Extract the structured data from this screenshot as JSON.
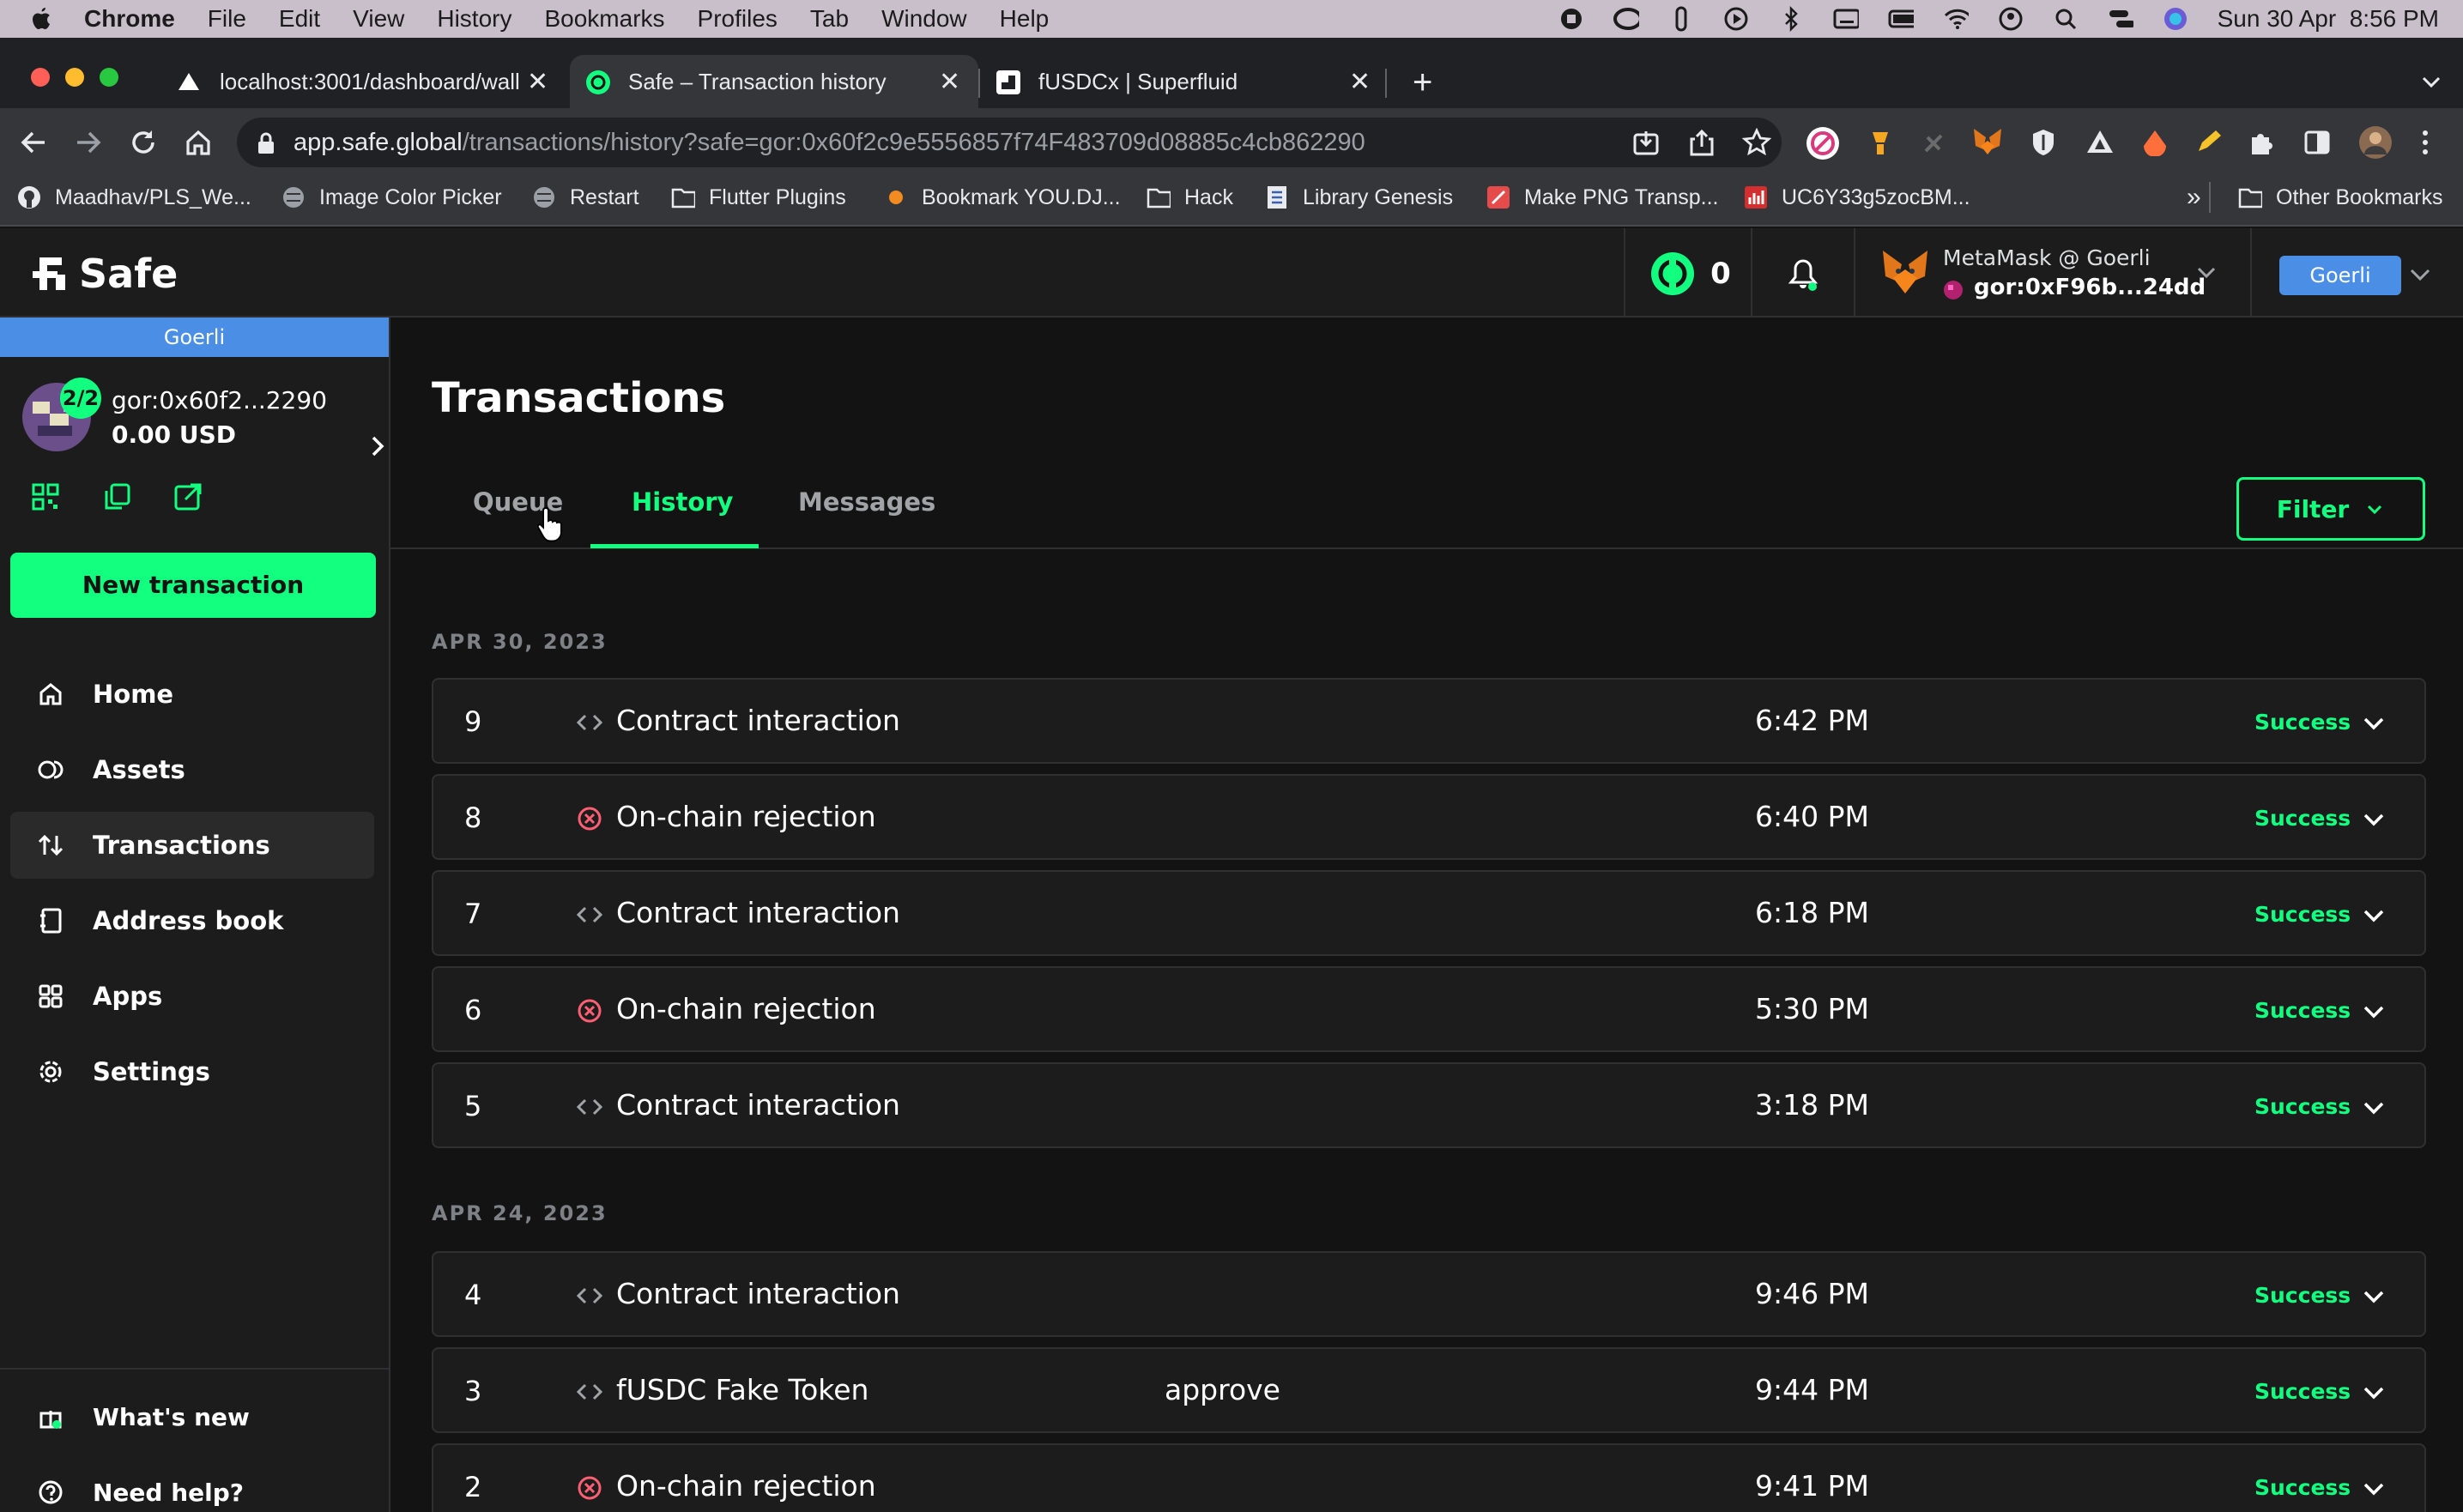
{
  "menubar": {
    "app": "Chrome",
    "items": [
      "File",
      "Edit",
      "View",
      "History",
      "Bookmarks",
      "Profiles",
      "Tab",
      "Window",
      "Help"
    ],
    "clock": "Sun 30 Apr  8:56 PM"
  },
  "browser": {
    "tabs": [
      {
        "title": "localhost:3001/dashboard/wall"
      },
      {
        "title": "Safe – Transaction history"
      },
      {
        "title": "fUSDCx | Superfluid"
      }
    ],
    "url_host": "app.safe.global",
    "url_path": "/transactions/history?safe=gor:0x60f2c9e5556857f74F483709d08885c4cb862290",
    "bookmarks": [
      "Maadhav/PLS_We...",
      "Image Color Picker",
      "Restart",
      "Flutter Plugins",
      "Bookmark YOU.DJ...",
      "Hack",
      "Library Genesis",
      "Make PNG Transp...",
      "UC6Y33g5zocBM..."
    ],
    "more_bookmarks": "»",
    "other_bookmarks": "Other Bookmarks"
  },
  "header": {
    "logo_text": "Safe",
    "pending_count": "0",
    "wallet_name": "MetaMask @ Goerli",
    "wallet_address": "gor:0xF96b...24dd",
    "network": "Goerli"
  },
  "sidebar": {
    "network": "Goerli",
    "threshold": "2/2",
    "safe_address": "gor:0x60f2...2290",
    "balance": "0.00 USD",
    "new_tx_label": "New transaction",
    "nav": [
      {
        "label": "Home"
      },
      {
        "label": "Assets"
      },
      {
        "label": "Transactions"
      },
      {
        "label": "Address book"
      },
      {
        "label": "Apps"
      },
      {
        "label": "Settings"
      }
    ],
    "whats_new": "What's new",
    "need_help": "Need help?"
  },
  "main": {
    "title": "Transactions",
    "tabs": [
      {
        "label": "Queue"
      },
      {
        "label": "History"
      },
      {
        "label": "Messages"
      }
    ],
    "filter_label": "Filter",
    "groups": [
      {
        "date": "APR 30, 2023",
        "rows": [
          {
            "nonce": "9",
            "type": "Contract interaction",
            "method": "",
            "time": "6:42 PM",
            "status": "Success"
          },
          {
            "nonce": "8",
            "type": "On-chain rejection",
            "method": "",
            "time": "6:40 PM",
            "status": "Success"
          },
          {
            "nonce": "7",
            "type": "Contract interaction",
            "method": "",
            "time": "6:18 PM",
            "status": "Success"
          },
          {
            "nonce": "6",
            "type": "On-chain rejection",
            "method": "",
            "time": "5:30 PM",
            "status": "Success"
          },
          {
            "nonce": "5",
            "type": "Contract interaction",
            "method": "",
            "time": "3:18 PM",
            "status": "Success"
          }
        ]
      },
      {
        "date": "APR 24, 2023",
        "rows": [
          {
            "nonce": "4",
            "type": "Contract interaction",
            "method": "",
            "time": "9:46 PM",
            "status": "Success"
          },
          {
            "nonce": "3",
            "type": "fUSDC Fake Token",
            "method": "approve",
            "time": "9:44 PM",
            "status": "Success"
          },
          {
            "nonce": "2",
            "type": "On-chain rejection",
            "method": "",
            "time": "9:41 PM",
            "status": "Success"
          }
        ]
      }
    ]
  },
  "colors": {
    "accent": "#12ff80",
    "background": "#121312",
    "panel": "#1c1c1c",
    "network": "#4a8ee6",
    "rejection": "#ff5f72"
  }
}
